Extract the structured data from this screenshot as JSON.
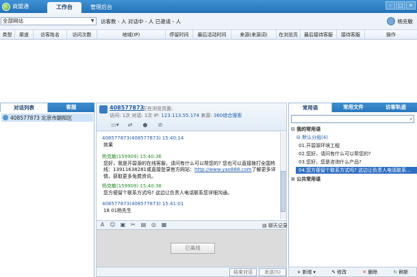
{
  "app": {
    "name": "商盟通"
  },
  "tabs": [
    {
      "label": "工作台"
    },
    {
      "label": "管理后台"
    }
  ],
  "toolbar": {
    "site_select": "全部网站",
    "stats": "访客数 - 人   对话中 - 人   已邀请 - 人",
    "user_name": "杨克敏"
  },
  "table_headers": [
    "类型",
    "渠道",
    "访客姓名",
    "访问次数",
    "地域(IP)",
    "停留时间",
    "最后活动时间",
    "来源(来源词)",
    "在浏览页",
    "最后接待客服",
    "接待客服",
    "操作"
  ],
  "left_panel": {
    "tabs": [
      {
        "label": "对话列表"
      },
      {
        "label": "客服"
      }
    ],
    "visitor": "408577873 北京市朝阳区"
  },
  "chat": {
    "visitor_id": "408577873",
    "browsing_label": "正在浏览页面:",
    "info_prefix": "访问: 1次  对话: 1次  IP: ",
    "ip": "123.113.55.174",
    "source_label": "  来源: ",
    "source": "360综合搜索",
    "messages": [
      {
        "header": "408577873(408577873)  15:40:14",
        "sender": "visitor",
        "text": "效果"
      },
      {
        "header": "杨克敏(159909)  15:40:36",
        "sender": "agent",
        "text": "您好，我是开碧源的在线客服，请问有什么可以帮您的? 您也可以直接拨打全国热线：13911638281或直接登录官方网站：",
        "link": "http://www.yao888.com",
        "text_after": "了解更多详情，获取更多免费资讯。"
      },
      {
        "header": "杨克敏(159909)  15:40:38",
        "sender": "agent",
        "text": "您方便留个联系方式吗? 这边让负责人电话联系您详细沟通。"
      },
      {
        "header": "408577873(408577873)  15:41:01",
        "sender": "visitor",
        "text": "18     01杨先生"
      }
    ],
    "history_label": "聊天记录",
    "offline_label": "已离线",
    "end_label": "结束对话",
    "send_label": "发送(S)"
  },
  "right_panel": {
    "tabs": [
      {
        "label": "常用语"
      },
      {
        "label": "常用文件"
      },
      {
        "label": "访客轨迹"
      }
    ],
    "tree": {
      "my_phrases": "我的常用语",
      "default_group": "默认分组(4)",
      "items": [
        "01.开碧源环境工程",
        "02.您好，请问有什么可以帮您的?",
        "03.您好，您是咨询什么产品?",
        "04.您方便留个联系方式吗? 这边让负责人电话联系..."
      ],
      "public_phrases": "公共常用语"
    },
    "actions": [
      {
        "label": "新增"
      },
      {
        "label": "修改"
      },
      {
        "label": "删除"
      },
      {
        "label": "刷新"
      }
    ]
  }
}
